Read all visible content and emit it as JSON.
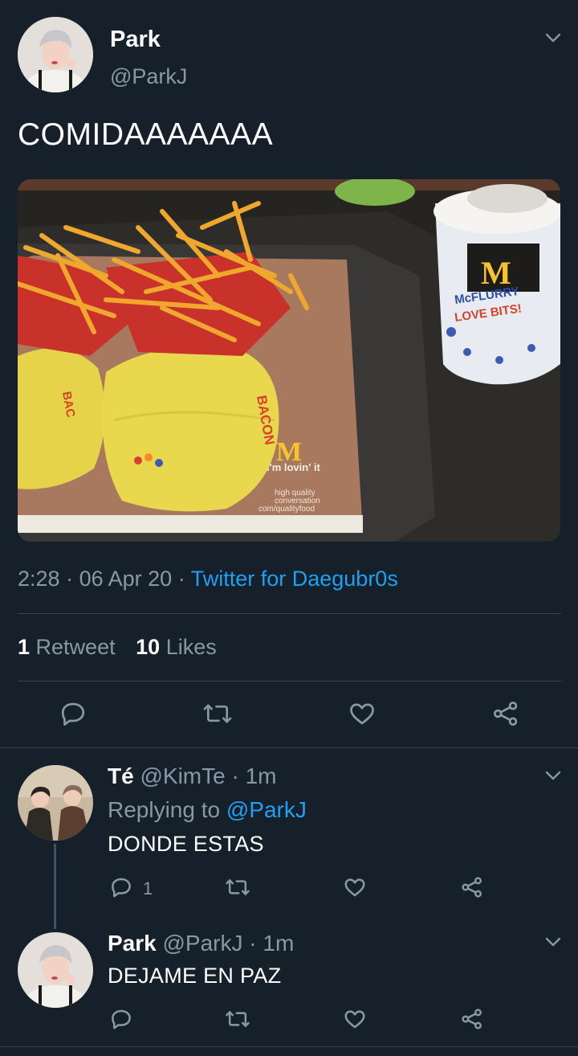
{
  "tweet": {
    "author_name": "Park",
    "author_handle": "@ParkJ",
    "text": "COMIDAAAAAAA",
    "time": "2:28",
    "date": "06 Apr 20",
    "sep": "·",
    "source": "Twitter for Daegubr0s",
    "media": {
      "tray_text_1": "i'm lovin' it",
      "tray_text_2": "high quality",
      "tray_text_3": "conversation",
      "tray_text_4": "com/qualityfood",
      "cup_text_1": "McFLURRY",
      "cup_text_2": "LOVE BITS!",
      "wrapper_text": "BACON"
    },
    "stats": {
      "retweets_count": "1",
      "retweets_label": "Retweet",
      "likes_count": "10",
      "likes_label": "Likes"
    }
  },
  "replies": [
    {
      "name": "Té",
      "handle": "@KimTe",
      "time": "· 1m",
      "replying_label": "Replying to",
      "replying_to": "@ParkJ",
      "text": "DONDE ESTAS",
      "reply_count": "1"
    },
    {
      "name": "Park",
      "handle": "@ParkJ",
      "time": "· 1m",
      "text": "DEJAME EN PAZ"
    }
  ],
  "icons": {
    "reply": "reply-icon",
    "retweet": "retweet-icon",
    "like": "heart-icon",
    "share": "share-icon",
    "more": "chevron-down-icon"
  },
  "colors": {
    "background": "#15202b",
    "link": "#1da1f2",
    "secondary_text": "#8899a6",
    "divider": "#38444d"
  }
}
